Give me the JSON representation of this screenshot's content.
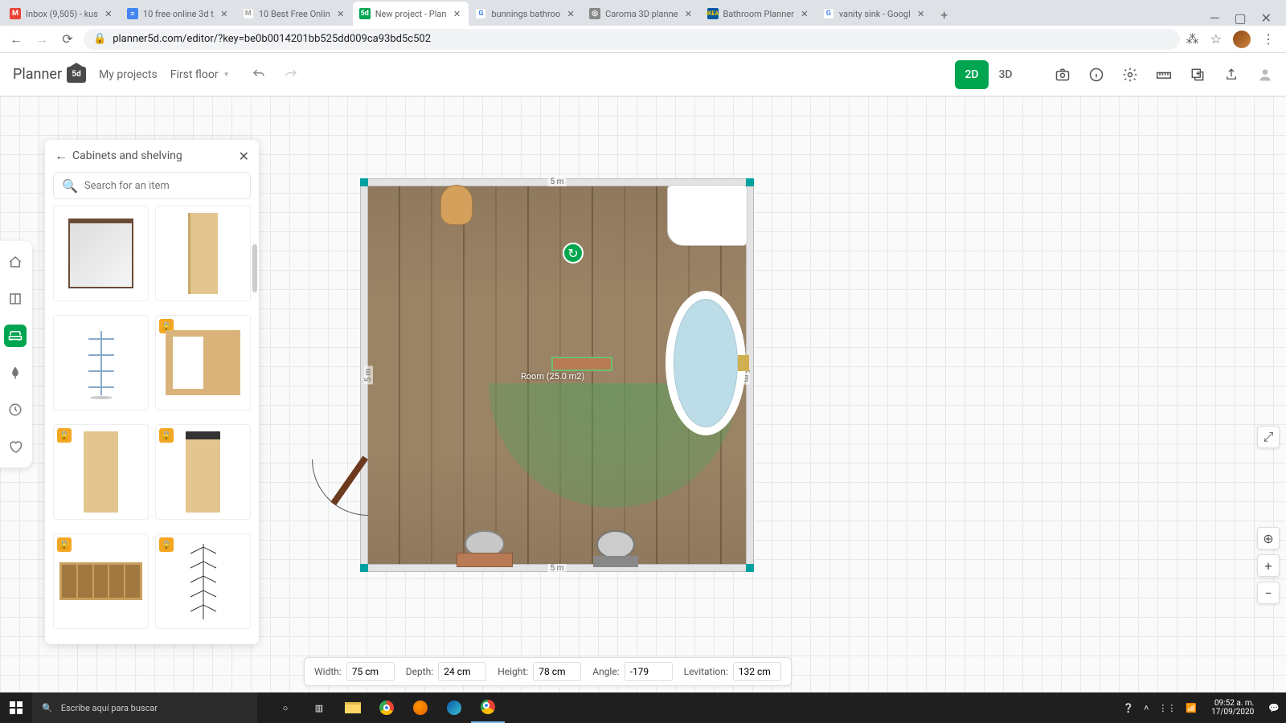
{
  "browser": {
    "tabs": [
      {
        "title": "Inbox (9,505) - kus",
        "fav": "M",
        "favbg": "#ea4335"
      },
      {
        "title": "10 free online 3d t",
        "fav": "≡",
        "favbg": "#4285f4"
      },
      {
        "title": "10 Best Free Onlin",
        "fav": "M",
        "favbg": "#999"
      },
      {
        "title": "New project - Plan",
        "fav": "5d",
        "favbg": "#00a550"
      },
      {
        "title": "bunnings bathroo",
        "fav": "G",
        "favbg": "#fff"
      },
      {
        "title": "Caroma 3D planne",
        "fav": "◎",
        "favbg": "#999"
      },
      {
        "title": "Bathroom Planner",
        "fav": "▬",
        "favbg": "#0058a3"
      },
      {
        "title": "vanity sink - Googl",
        "fav": "G",
        "favbg": "#fff"
      }
    ],
    "active_tab": 3,
    "url": "planner5d.com/editor/?key=be0b0014201bb525dd009ca93bd5c502"
  },
  "app": {
    "brand": "Planner",
    "brand_badge": "5d",
    "my_projects": "My projects",
    "floor": "First floor",
    "view_2d": "2D",
    "view_3d": "3D"
  },
  "panel": {
    "title": "Cabinets and shelving",
    "search_placeholder": "Search for an item"
  },
  "plan": {
    "dim_top": "5 m",
    "dim_bottom": "5 m",
    "dim_left": "5 m",
    "dim_right": "5 m",
    "room_label": "Room (25.0 m2)"
  },
  "props": {
    "width_label": "Width:",
    "width": "75 cm",
    "depth_label": "Depth:",
    "depth": "24 cm",
    "height_label": "Height:",
    "height": "78 cm",
    "angle_label": "Angle:",
    "angle": "-179",
    "lev_label": "Levitation:",
    "lev": "132 cm"
  },
  "taskbar": {
    "search": "Escribe aquí para buscar",
    "time": "09:52 a. m.",
    "date": "17/09/2020"
  }
}
